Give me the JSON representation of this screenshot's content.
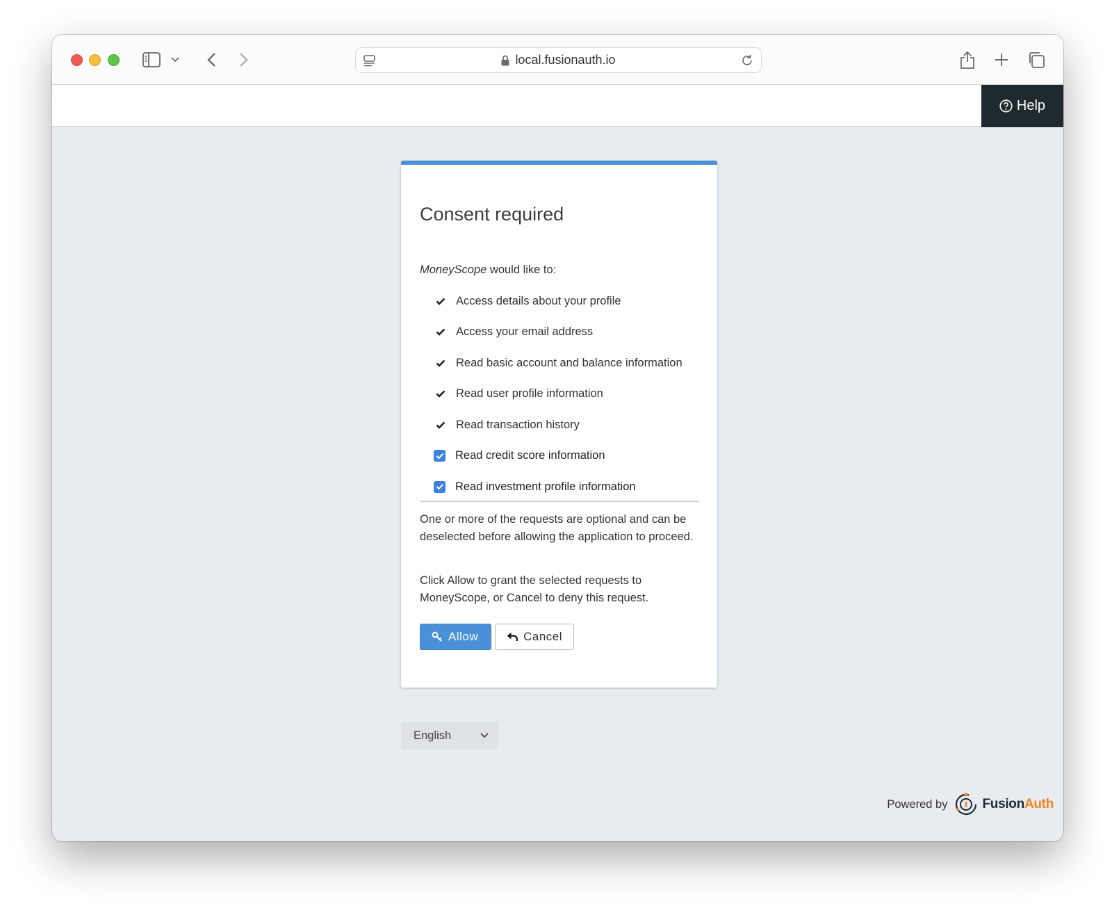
{
  "browser": {
    "url": "local.fusionauth.io"
  },
  "header": {
    "help_label": "Help"
  },
  "consent": {
    "title": "Consent required",
    "app_name": "MoneyScope",
    "intro_suffix": " would like to:",
    "required_scopes": [
      "Access details about your profile",
      "Access your email address",
      "Read basic account and balance information",
      "Read user profile information",
      "Read transaction history"
    ],
    "optional_scopes": [
      {
        "label": "Read credit score information",
        "checked": true
      },
      {
        "label": "Read investment profile information",
        "checked": true
      }
    ],
    "optional_note": "One or more of the requests are optional and can be deselected before allowing the application to proceed.",
    "instructions": "Click Allow to grant the selected requests to MoneyScope, or Cancel to deny this request.",
    "allow_label": "Allow",
    "cancel_label": "Cancel"
  },
  "locale": {
    "selected": "English"
  },
  "footer": {
    "powered_by": "Powered by",
    "brand_part1": "Fusion",
    "brand_part2": "Auth"
  },
  "colors": {
    "accent": "#4a90d9",
    "help_bg": "#1f2a2e",
    "brand_orange": "#f58320"
  }
}
